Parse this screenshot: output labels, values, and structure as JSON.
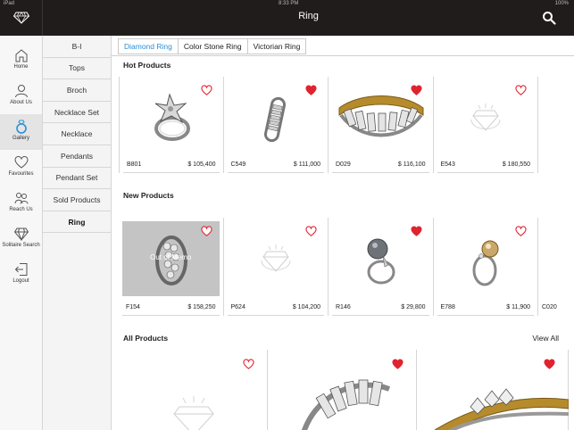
{
  "status": {
    "left": "iPad",
    "center": "8:33 PM",
    "right": "100%"
  },
  "header": {
    "title": "Ring"
  },
  "nav": [
    {
      "label": "Home",
      "icon": "home-icon"
    },
    {
      "label": "About Us",
      "icon": "person-icon"
    },
    {
      "label": "Gallery",
      "icon": "ring-icon",
      "active": true
    },
    {
      "label": "Favourites",
      "icon": "heart-icon"
    },
    {
      "label": "Reach Us",
      "icon": "people-icon"
    },
    {
      "label": "Solitaire Search",
      "icon": "diamond-icon"
    },
    {
      "label": "Logout",
      "icon": "logout-icon"
    }
  ],
  "categories": [
    "B-I",
    "Tops",
    "Broch",
    "Necklace Set",
    "Necklace",
    "Pendants",
    "Pendant Set",
    "Sold Products",
    "Ring"
  ],
  "active_category": "Ring",
  "tabs": [
    "Diamond Ring",
    "Color Stone Ring",
    "Victorian Ring"
  ],
  "active_tab": "Diamond Ring",
  "hot_products": {
    "title": "Hot Products",
    "items": [
      {
        "code": "B801",
        "price": "$ 105,400",
        "favourite": false
      },
      {
        "code": "C549",
        "price": "$ 111,000",
        "favourite": true
      },
      {
        "code": "D029",
        "price": "$ 116,100",
        "favourite": true
      },
      {
        "code": "E543",
        "price": "$ 180,550",
        "favourite": false
      }
    ]
  },
  "new_products": {
    "title": "New Products",
    "items": [
      {
        "code": "F154",
        "price": "$ 158,250",
        "favourite": false,
        "overlay": "Out of Memo"
      },
      {
        "code": "P624",
        "price": "$ 104,200",
        "favourite": false
      },
      {
        "code": "R146",
        "price": "$ 29,800",
        "favourite": true
      },
      {
        "code": "E788",
        "price": "$ 11,900",
        "favourite": false
      },
      {
        "code": "C020",
        "price": "",
        "favourite": false
      }
    ]
  },
  "all_products": {
    "title": "All Products",
    "view_all": "View All",
    "favourites": [
      false,
      true,
      true
    ]
  },
  "colors": {
    "topbar": "#1f1c1b",
    "accent": "#2b8fd6",
    "heart": "#e0242f"
  }
}
